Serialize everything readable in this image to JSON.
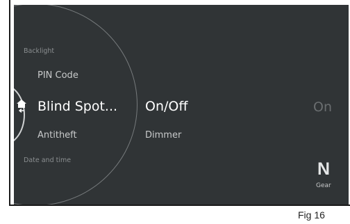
{
  "menu": {
    "items": [
      {
        "label": "Backlight"
      },
      {
        "label": "PIN Code"
      },
      {
        "label": "Blind Spot..."
      },
      {
        "label": "Antitheft"
      },
      {
        "label": "Date and time"
      }
    ],
    "selected_index": 2,
    "home_icon": "home-back-icon"
  },
  "submenu": {
    "items": [
      {
        "label": "On/Off"
      },
      {
        "label": "Dimmer"
      }
    ],
    "selected_index": 0
  },
  "current_value": "On",
  "gear": {
    "value": "N",
    "label": "Gear"
  },
  "figure_label": "Fig 16",
  "colors": {
    "screen_background": "#303436",
    "selected_text": "#ffffff",
    "dim_text": "#8a8e90",
    "value_text": "#6a6e70"
  }
}
